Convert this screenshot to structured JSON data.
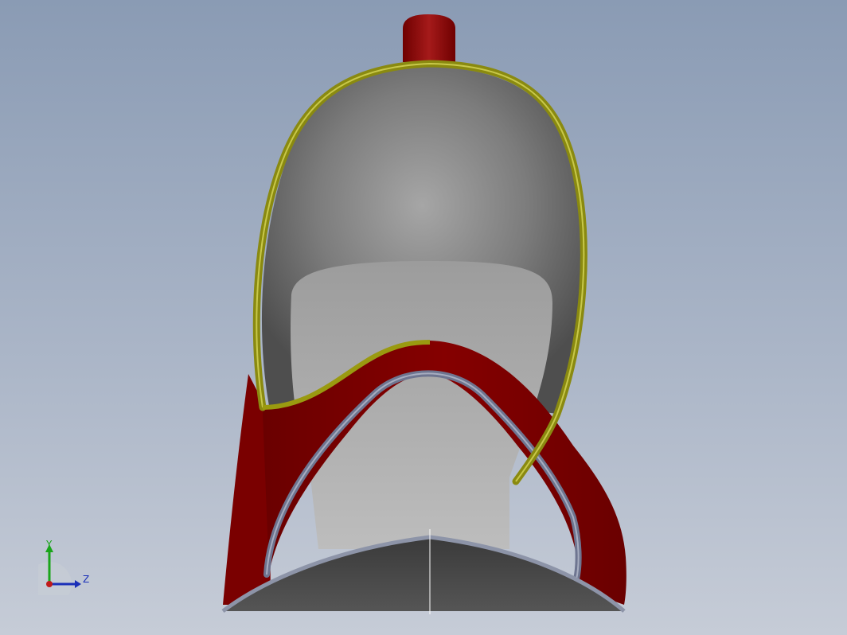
{
  "viewport": {
    "background_top": "#8a9bb4",
    "background_bottom": "#c6ccd7"
  },
  "model": {
    "part": "shoe",
    "colors": {
      "upper_red": "#7a0000",
      "trim_yellow": "#9a9a10",
      "inner_gray": "#8c8c8c",
      "sole_dark": "#4a4a4a",
      "strap_blue_gray": "#6e7590"
    }
  },
  "triad": {
    "y_label": "Y",
    "z_label": "Z",
    "y_color": "#1aa51a",
    "z_color": "#1a2fb8",
    "x_color": "#c01a1a"
  }
}
